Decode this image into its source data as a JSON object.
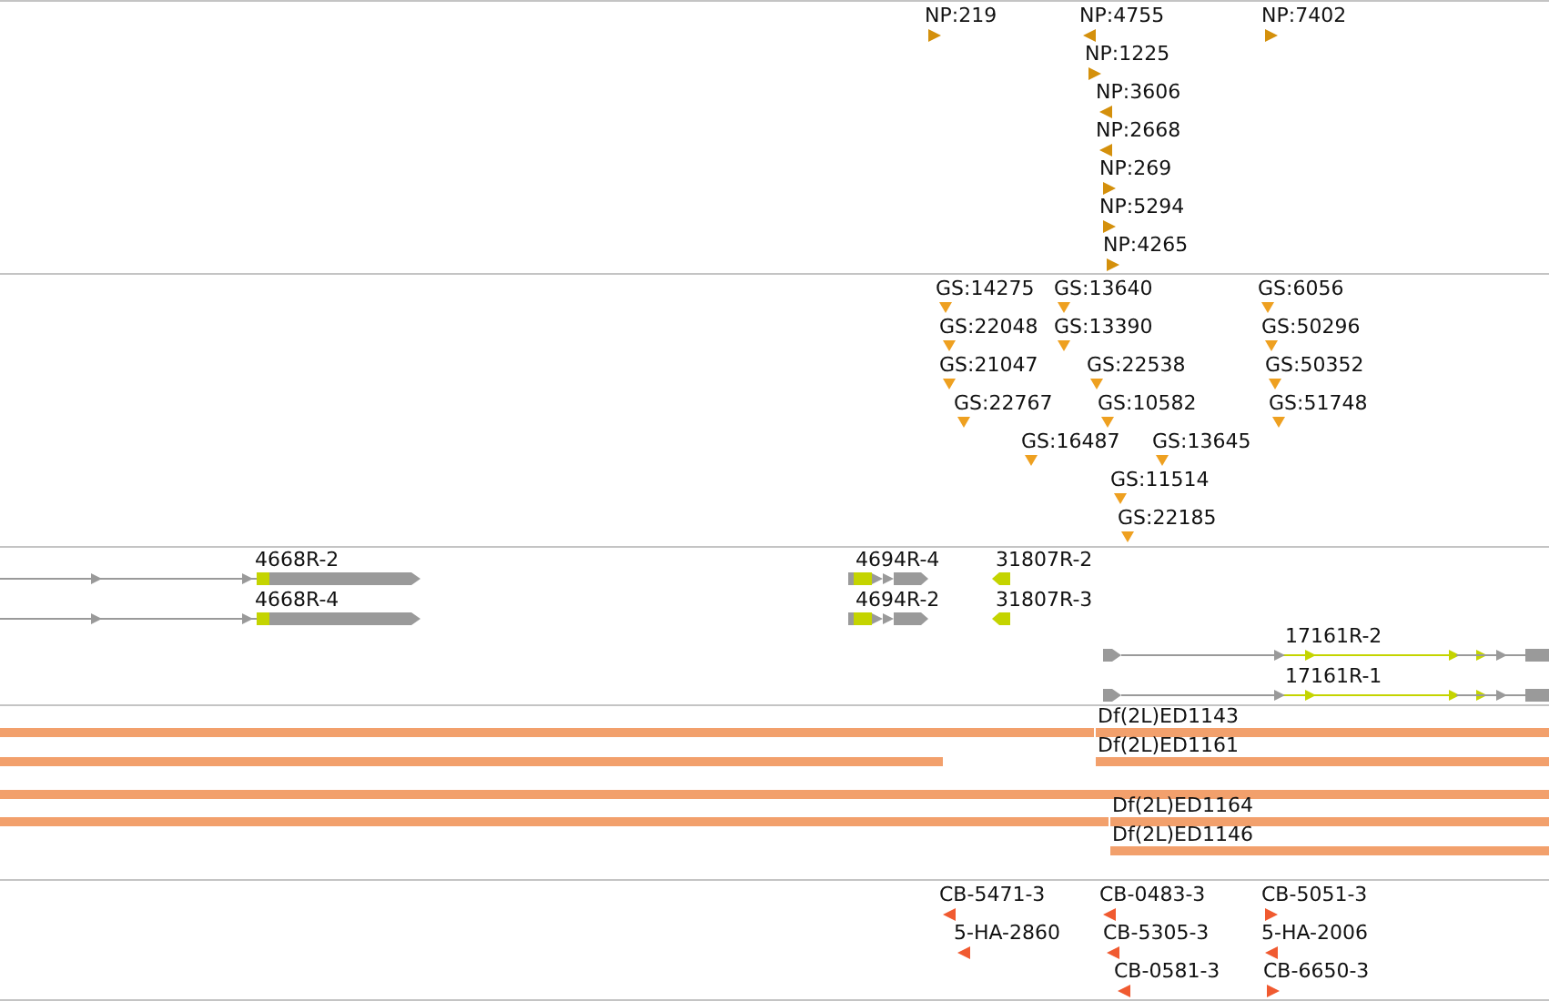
{
  "np_track": {
    "kind": "stranded",
    "color": "#d4900c",
    "features": [
      {
        "label": "NP:219",
        "reverse": false
      },
      {
        "label": "NP:4755",
        "reverse": true
      },
      {
        "label": "NP:7402",
        "reverse": false
      },
      {
        "label": "NP:1225",
        "reverse": false
      },
      {
        "label": "NP:3606",
        "reverse": true
      },
      {
        "label": "NP:2668",
        "reverse": true
      },
      {
        "label": "NP:269",
        "reverse": false
      },
      {
        "label": "NP:5294",
        "reverse": false
      },
      {
        "label": "NP:4265",
        "reverse": false
      }
    ]
  },
  "gs_track": {
    "kind": "unstranded",
    "color": "#eea020",
    "features": [
      {
        "label": "GS:14275"
      },
      {
        "label": "GS:13640"
      },
      {
        "label": "GS:6056"
      },
      {
        "label": "GS:22048"
      },
      {
        "label": "GS:13390"
      },
      {
        "label": "GS:50296"
      },
      {
        "label": "GS:21047"
      },
      {
        "label": "GS:22538"
      },
      {
        "label": "GS:50352"
      },
      {
        "label": "GS:22767"
      },
      {
        "label": "GS:10582"
      },
      {
        "label": "GS:51748"
      },
      {
        "label": "GS:16487"
      },
      {
        "label": "GS:13645"
      },
      {
        "label": "GS:11514"
      },
      {
        "label": "GS:22185"
      }
    ]
  },
  "transcript_track": {
    "transcripts": [
      {
        "label": "4668R-2"
      },
      {
        "label": "4668R-4"
      },
      {
        "label": "4694R-4"
      },
      {
        "label": "4694R-2"
      },
      {
        "label": "31807R-2"
      },
      {
        "label": "31807R-3"
      },
      {
        "label": "17161R-2"
      },
      {
        "label": "17161R-1"
      }
    ]
  },
  "deficiency_track": {
    "deficiencies": [
      {
        "label": "Df(2L)ED1143"
      },
      {
        "label": "Df(2L)ED1161"
      },
      {
        "label": "Df(2L)ED1164"
      },
      {
        "label": "Df(2L)ED1146"
      }
    ]
  },
  "cb_track": {
    "kind": "stranded",
    "color": "#f05a30",
    "features": [
      {
        "label": "CB-5471-3",
        "reverse": true
      },
      {
        "label": "CB-0483-3",
        "reverse": true
      },
      {
        "label": "CB-5051-3",
        "reverse": false
      },
      {
        "label": "5-HA-2860",
        "reverse": true
      },
      {
        "label": "CB-5305-3",
        "reverse": true
      },
      {
        "label": "5-HA-2006",
        "reverse": true
      },
      {
        "label": "CB-0581-3",
        "reverse": true
      },
      {
        "label": "CB-6650-3",
        "reverse": false
      }
    ]
  }
}
